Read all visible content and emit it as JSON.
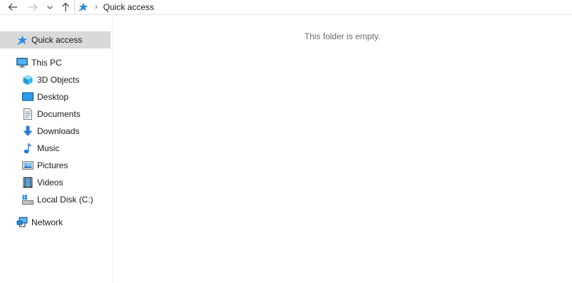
{
  "toolbar": {
    "back_icon": "arrow-left-icon",
    "forward_icon": "arrow-right-icon",
    "recent_icon": "chevron-down-icon",
    "up_icon": "arrow-up-icon"
  },
  "address": {
    "icon": "quick-access-star-icon",
    "separator": "›",
    "location": "Quick access"
  },
  "navpane": {
    "quick_access": "Quick access",
    "this_pc": "This PC",
    "items": [
      {
        "label": "3D Objects",
        "icon": "3d-objects-icon"
      },
      {
        "label": "Desktop",
        "icon": "desktop-icon"
      },
      {
        "label": "Documents",
        "icon": "documents-icon"
      },
      {
        "label": "Downloads",
        "icon": "downloads-icon"
      },
      {
        "label": "Music",
        "icon": "music-icon"
      },
      {
        "label": "Pictures",
        "icon": "pictures-icon"
      },
      {
        "label": "Videos",
        "icon": "videos-icon"
      },
      {
        "label": "Local Disk (C:)",
        "icon": "local-disk-icon"
      }
    ],
    "network": "Network"
  },
  "content": {
    "empty_message": "This folder is empty."
  },
  "colors": {
    "accent_blue": "#2b8ae0",
    "selection_bg": "#d9d9d9",
    "muted_text": "#6d6d6d"
  }
}
